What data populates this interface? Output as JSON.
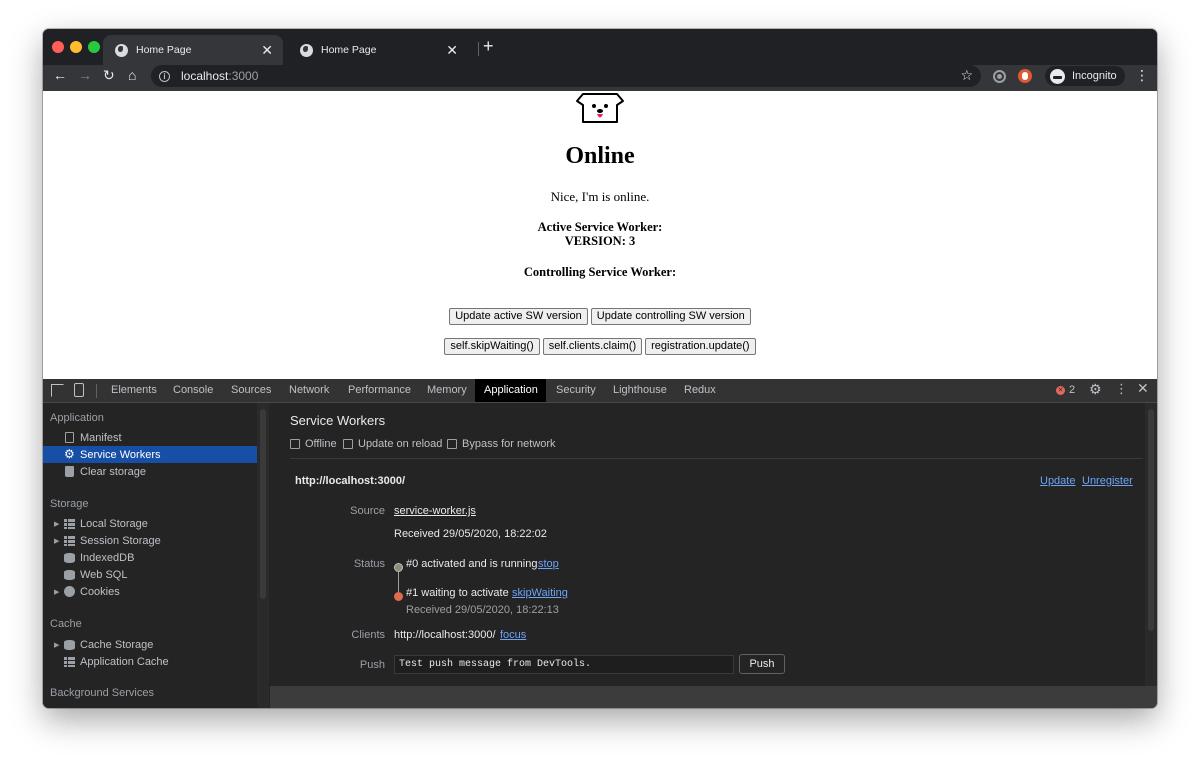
{
  "browser": {
    "tabs": [
      {
        "title": "Home Page",
        "close": "✕"
      },
      {
        "title": "Home Page",
        "close": "✕"
      }
    ],
    "new_tab": "+",
    "url_host": "localhost",
    "url_port": ":3000",
    "profile_label": "Incognito",
    "colors": {
      "traffic_red": "#ff5f57",
      "traffic_yellow": "#febc2e",
      "traffic_green": "#28c840"
    }
  },
  "page": {
    "heading": "Online",
    "message": "Nice, I'm is online.",
    "active_sw_label": "Active Service Worker:",
    "active_sw_version": "VERSION: 3",
    "controlling_sw_label": "Controlling Service Worker:",
    "buttons_row1": [
      "Update active SW version",
      "Update controlling SW version"
    ],
    "buttons_row2": [
      "self.skipWaiting()",
      "self.clients.claim()",
      "registration.update()"
    ]
  },
  "devtools": {
    "tabs": [
      "Elements",
      "Console",
      "Sources",
      "Network",
      "Performance",
      "Memory",
      "Application",
      "Security",
      "Lighthouse",
      "Redux"
    ],
    "selected_tab": "Application",
    "error_count": "2",
    "sidebar": {
      "application_header": "Application",
      "application_items": [
        "Manifest",
        "Service Workers",
        "Clear storage"
      ],
      "selected_item": "Service Workers",
      "storage_header": "Storage",
      "storage_items": [
        "Local Storage",
        "Session Storage",
        "IndexedDB",
        "Web SQL",
        "Cookies"
      ],
      "cache_header": "Cache",
      "cache_items": [
        "Cache Storage",
        "Application Cache"
      ],
      "background_header": "Background Services"
    },
    "service_workers": {
      "title": "Service Workers",
      "options": [
        "Offline",
        "Update on reload",
        "Bypass for network"
      ],
      "origin": "http://localhost:3000/",
      "update_link": "Update",
      "unregister_link": "Unregister",
      "source_label": "Source",
      "source_file": "service-worker.js",
      "received": "Received 29/05/2020, 18:22:02",
      "status_label": "Status",
      "status_active": "#0 activated and is running",
      "stop_link": "stop",
      "status_waiting": "#1 waiting to activate",
      "skip_link": "skipWaiting",
      "waiting_received": "Received 29/05/2020, 18:22:13",
      "clients_label": "Clients",
      "clients_value": "http://localhost:3000/",
      "focus_link": "focus",
      "push_label": "Push",
      "push_value": "Test push message from DevTools.",
      "push_button": "Push"
    }
  }
}
